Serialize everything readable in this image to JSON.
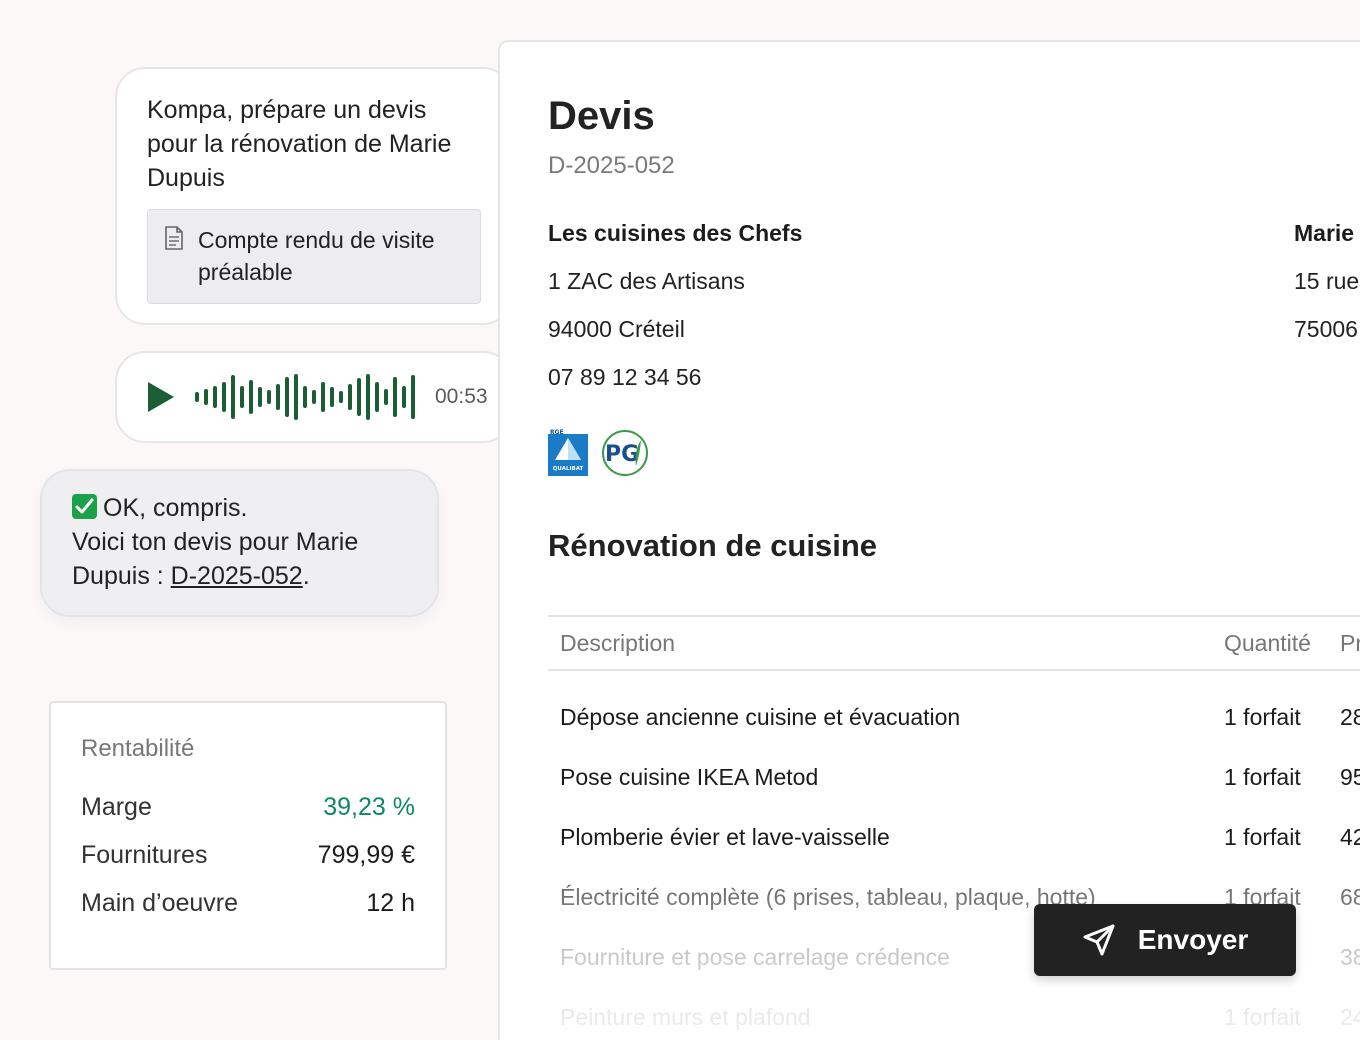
{
  "chat": {
    "request_message": "Kompa, prépare un devis pour la rénovation de Marie Dupuis",
    "attachment_label": "Compte rendu de visite préalable",
    "attachment_icon": "document-icon",
    "audio_duration": "00:53",
    "reply_line1": "OK, compris.",
    "reply_line2": "Voici ton devis pour Marie Dupuis : ",
    "reply_ref": "D-2025-052",
    "reply_suffix": "."
  },
  "profit": {
    "title": "Rentabilité",
    "rows": [
      {
        "label": "Marge",
        "value": "39,23 %"
      },
      {
        "label": "Fournitures",
        "value": "799,99 €"
      },
      {
        "label": "Main d’oeuvre",
        "value": "12 h"
      }
    ],
    "accent_color": "#0f8a5f"
  },
  "devis": {
    "title": "Devis",
    "number": "D-2025-052",
    "company": {
      "name": "Les cuisines des Chefs",
      "address1": "1 ZAC des Artisans",
      "address2": "94000 Créteil",
      "phone": "07 89 12 34 56"
    },
    "client": {
      "name": "Marie",
      "address1": "15 rue",
      "address2": "75006"
    },
    "certifications": {
      "rge_badge": "RGE",
      "rge_label": "QUALIBAT",
      "pg_label": "PG"
    },
    "section_title": "Rénovation de cuisine",
    "table": {
      "headers": {
        "description": "Description",
        "quantity": "Quantité",
        "price": "Pr"
      },
      "rows": [
        {
          "description": "Dépose ancienne cuisine et évacuation",
          "quantity": "1 forfait",
          "price": "28"
        },
        {
          "description": "Pose cuisine IKEA Metod",
          "quantity": "1 forfait",
          "price": "95"
        },
        {
          "description": "Plomberie évier et lave-vaisselle",
          "quantity": "1 forfait",
          "price": "42"
        },
        {
          "description": "Électricité complète (6 prises, tableau, plaque, hotte)",
          "quantity": "1 forfait",
          "price": "68"
        },
        {
          "description": "Fourniture et pose carrelage crédence",
          "quantity": "",
          "price": "38"
        },
        {
          "description": "Peinture murs et plafond",
          "quantity": "1 forfait",
          "price": "24"
        }
      ]
    }
  },
  "send_button": {
    "label": "Envoyer",
    "icon": "send-icon"
  }
}
